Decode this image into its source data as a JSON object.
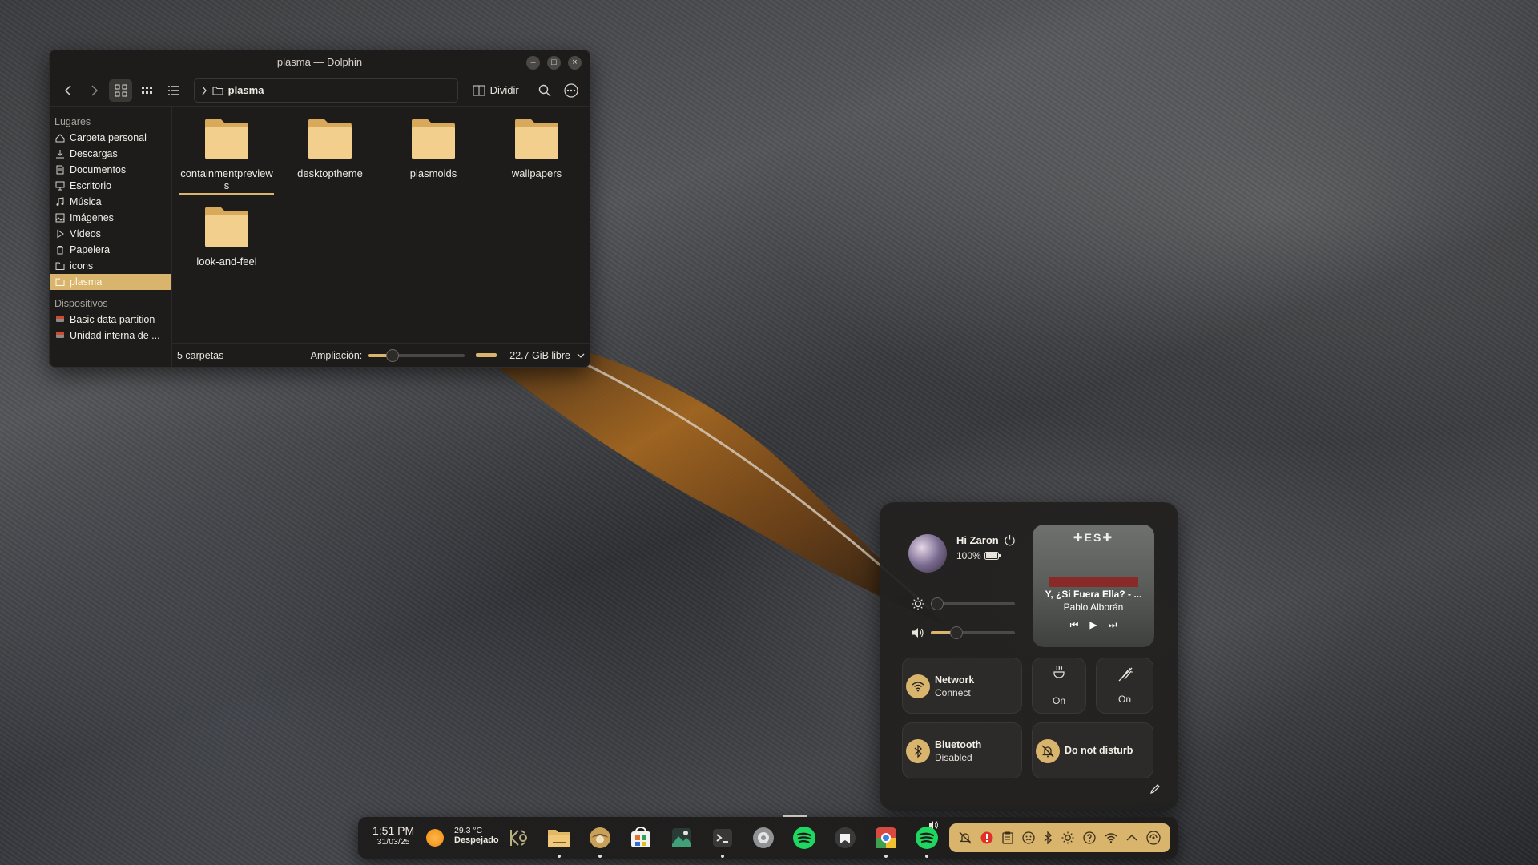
{
  "dolphin": {
    "title": "plasma — Dolphin",
    "split_label": "Dividir",
    "path": "plasma",
    "places_header": "Lugares",
    "devices_header": "Dispositivos",
    "places": [
      {
        "label": "Carpeta personal",
        "icon": "home-icon"
      },
      {
        "label": "Descargas",
        "icon": "download-icon"
      },
      {
        "label": "Documentos",
        "icon": "document-icon"
      },
      {
        "label": "Escritorio",
        "icon": "desktop-icon"
      },
      {
        "label": "Música",
        "icon": "music-icon"
      },
      {
        "label": "Imágenes",
        "icon": "image-icon"
      },
      {
        "label": "Vídeos",
        "icon": "video-icon"
      },
      {
        "label": "Papelera",
        "icon": "trash-icon"
      },
      {
        "label": "icons",
        "icon": "folder-icon"
      },
      {
        "label": "plasma",
        "icon": "folder-icon",
        "selected": true
      }
    ],
    "devices": [
      {
        "label": "Basic data partition",
        "icon": "drive-icon"
      },
      {
        "label": "Unidad interna de ...",
        "icon": "drive-icon"
      }
    ],
    "files": [
      {
        "name": "containmentpreviews"
      },
      {
        "name": "desktoptheme"
      },
      {
        "name": "plasmoids"
      },
      {
        "name": "wallpapers"
      },
      {
        "name": "look-and-feel"
      }
    ],
    "status": {
      "count": "5 carpetas",
      "zoom_label": "Ampliación:",
      "zoom_level": 0.25,
      "free_space": "22.7 GiB libre"
    },
    "accent": "#d9b46c"
  },
  "control_center": {
    "greeting": "Hi Zaron",
    "battery": "100%",
    "brightness": 0.05,
    "volume": 0.3,
    "media": {
      "song": "Y, ¿Si Fuera Ella? - ...",
      "artist": "Pablo Alborán"
    },
    "network": {
      "title": "Network",
      "subtitle": "Connect"
    },
    "caffeine": {
      "label": "On"
    },
    "night": {
      "label": "On"
    },
    "bluetooth": {
      "title": "Bluetooth",
      "subtitle": "Disabled"
    },
    "dnd": {
      "title": "Do not disturb"
    }
  },
  "taskbar": {
    "time": "1:51 PM",
    "date": "31/03/25",
    "temperature": "29.3 °C",
    "weather": "Despejado"
  }
}
